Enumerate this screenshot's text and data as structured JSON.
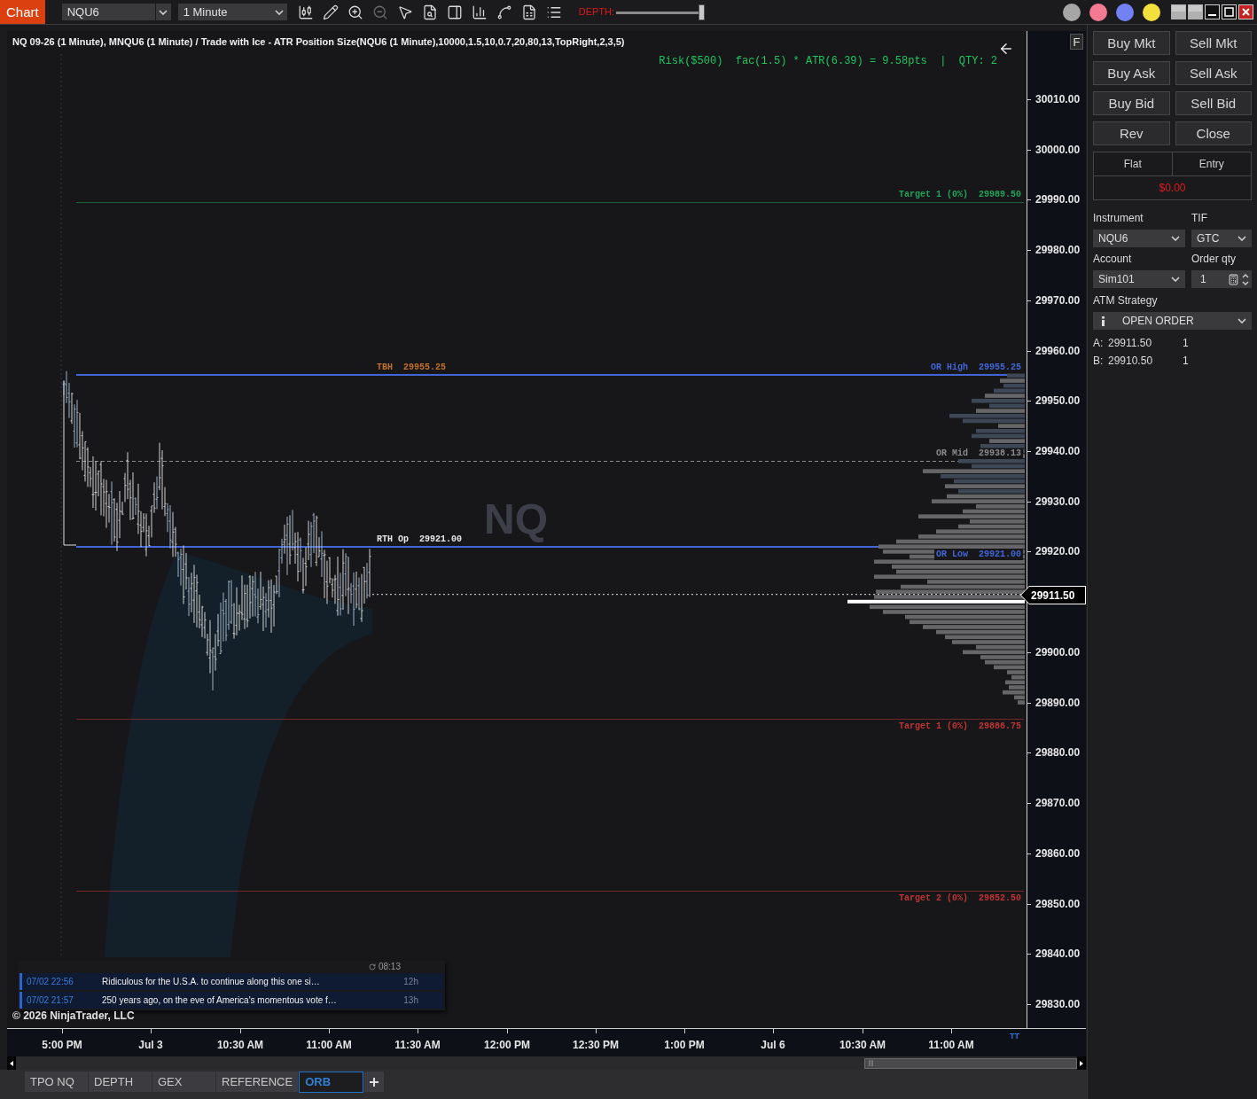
{
  "toolbar": {
    "app_label": "Chart",
    "instrument": "NQU6",
    "interval": "1 Minute",
    "depth": {
      "label": "DEPTH:",
      "level": 1
    }
  },
  "swatches": [
    {
      "color": "#a6a6a6"
    },
    {
      "color": "#f27a93"
    },
    {
      "color": "#7382f3"
    },
    {
      "color": "#f3e03c"
    }
  ],
  "chart": {
    "title": "NQ 09-26 (1 Minute), MNQU6 (1 Minute) / Trade with Ice - ATR Position Size(NQU6 (1 Minute),10000,1.5,10,0.7,20,80,13,TopRight,2,3,5)",
    "risk_summary": "Risk($500)  fac(1.5) * ATR(6.39) = 9.58pts  |  QTY: 2",
    "axis_button": "F",
    "watermark": "NQ",
    "levels": [
      {
        "kind": "thin",
        "label": "Target 1 (0%)",
        "value": "29989.50",
        "color": "#22a35a"
      },
      {
        "kind": "bold",
        "label": "OR High",
        "value": "29955.25",
        "color": "#4266d8"
      },
      {
        "kind": "dashed",
        "label": "OR Mid",
        "value": "29938.13",
        "color": "#8a8a8a"
      },
      {
        "kind": "bold",
        "label": "OR Low",
        "value": "29921.00",
        "color": "#4266d8"
      },
      {
        "kind": "thin",
        "label": "Target 1 (0%)",
        "value": "29886.75",
        "color": "#c03434"
      },
      {
        "kind": "thin",
        "label": "Target 2 (0%)",
        "value": "29852.50",
        "color": "#c03434"
      }
    ],
    "session_labels": [
      {
        "label": "TBH",
        "value": "29955.25",
        "color": "#c2702c"
      },
      {
        "label": "RTH Op",
        "value": "29921.00",
        "color": "#e6e6e6"
      }
    ],
    "last_price": "29911.50",
    "price_axis": [
      "30010.00",
      "30000.00",
      "29990.00",
      "29980.00",
      "29970.00",
      "29960.00",
      "29950.00",
      "29940.00",
      "29930.00",
      "29920.00",
      "29900.00",
      "29890.00",
      "29880.00",
      "29870.00",
      "29860.00",
      "29850.00",
      "29840.00",
      "29830.00"
    ],
    "time_axis": [
      "5:00 PM",
      "Jul 3",
      "10:30 AM",
      "11:00 AM",
      "11:30 AM",
      "12:00 PM",
      "12:30 PM",
      "1:00 PM",
      "Jul 6",
      "10:30 AM",
      "11:00 AM"
    ],
    "time_axis_badge": "TT",
    "news": {
      "time": "08:13",
      "items": [
        {
          "date": "07/02 22:56",
          "headline": "Ridiculous for the U.S.A. to continue along this one si…",
          "age": "12h"
        },
        {
          "date": "07/02 21:57",
          "headline": "250 years ago, on the eve of America's momentous vote f…",
          "age": "13h"
        }
      ]
    },
    "copyright": "© 2026 NinjaTrader, LLC"
  },
  "tabs": [
    {
      "label": "TPO NQ",
      "selected": false
    },
    {
      "label": "DEPTH",
      "selected": false
    },
    {
      "label": "GEX",
      "selected": false
    },
    {
      "label": "REFERENCE",
      "selected": false
    },
    {
      "label": "ORB",
      "selected": true
    }
  ],
  "order_panel": {
    "buttons": [
      "Buy Mkt",
      "Sell Mkt",
      "Buy Ask",
      "Sell Ask",
      "Buy Bid",
      "Sell Bid",
      "Rev",
      "Close"
    ],
    "position": {
      "status": "Flat",
      "entry_label": "Entry",
      "pnl": "$0.00"
    },
    "fields": [
      {
        "kind": "select",
        "label": "Instrument",
        "value": "NQU6"
      },
      {
        "kind": "select",
        "label": "TIF",
        "value": "GTC"
      },
      {
        "kind": "select",
        "label": "Account",
        "value": "Sim101"
      },
      {
        "kind": "spinner",
        "label": "Order qty",
        "value": "1"
      }
    ],
    "atm_strategy": {
      "label": "ATM Strategy",
      "value": "OPEN ORDER"
    },
    "quotes": [
      {
        "side": "A:",
        "price": "29911.50",
        "size": "1"
      },
      {
        "side": "B:",
        "price": "29910.50",
        "size": "1"
      }
    ]
  }
}
